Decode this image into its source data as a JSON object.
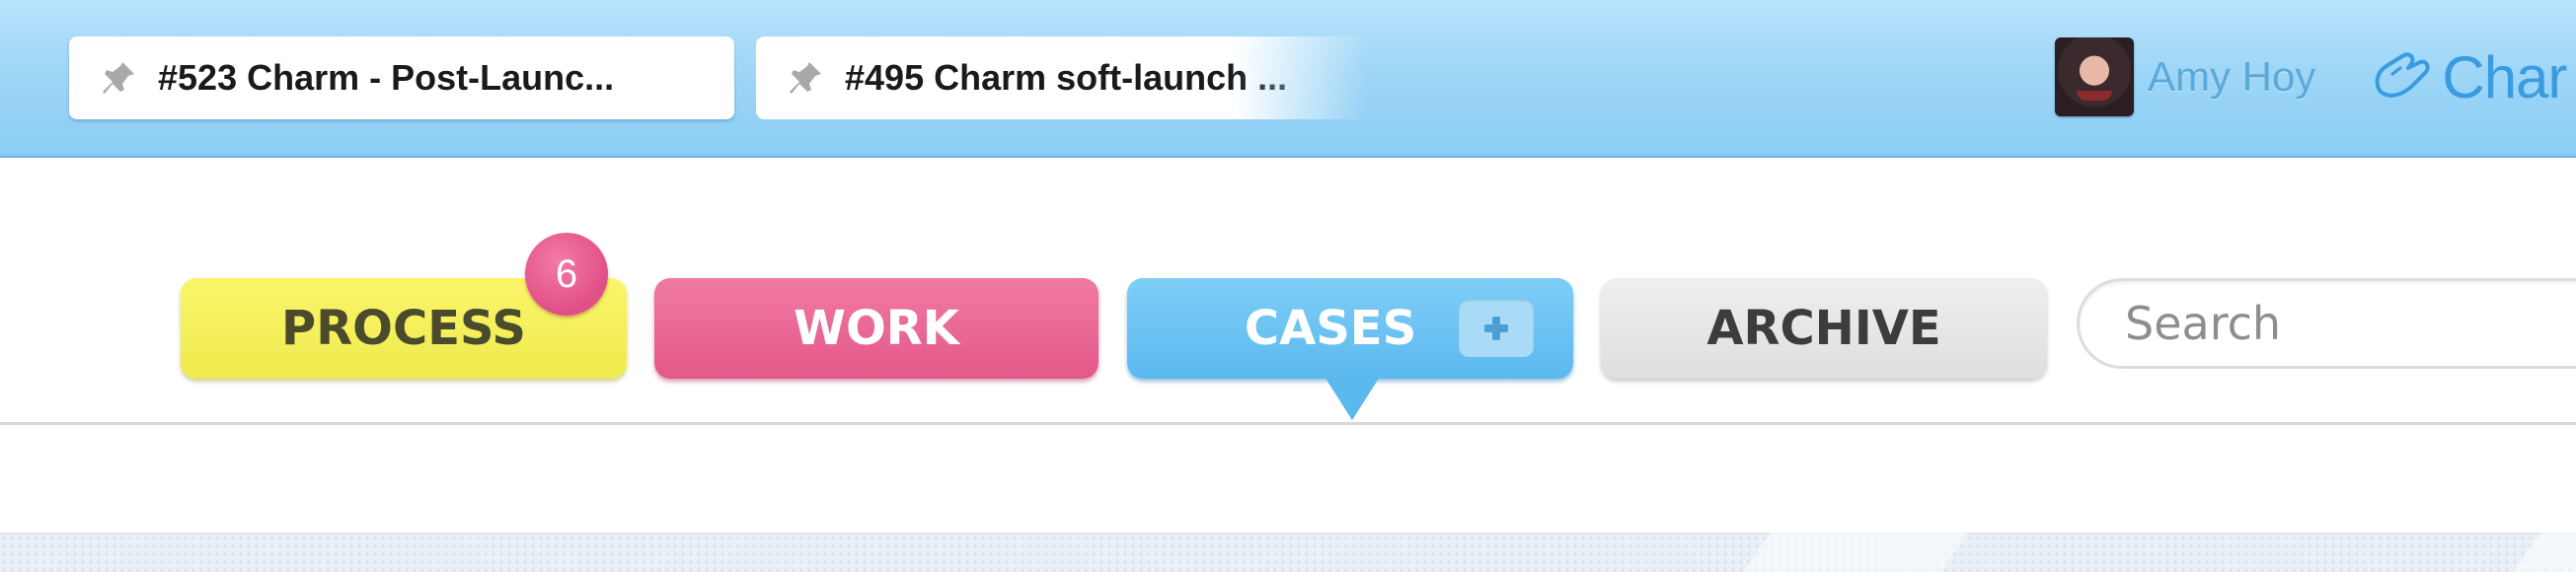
{
  "topbar": {
    "pinned_tabs": [
      {
        "label": "#523 Charm - Post-Launc..."
      },
      {
        "label": "#495 Charm soft-launch ..."
      }
    ],
    "user": {
      "name": "Amy Hoy"
    },
    "brand": {
      "name": "Char"
    }
  },
  "nav": {
    "process": {
      "label": "PROCESS",
      "badge": "6"
    },
    "work": {
      "label": "WORK"
    },
    "cases": {
      "label": "CASES",
      "active": true
    },
    "archive": {
      "label": "ARCHIVE"
    }
  },
  "search": {
    "placeholder": "Search",
    "value": ""
  },
  "colors": {
    "topbar": "#9fd6f7",
    "process": "#f4f05a",
    "work": "#e8648f",
    "cases": "#62bdf0",
    "archive": "#e5e5e5",
    "badge": "#e5538a"
  },
  "icons": {
    "pin": "pin-icon",
    "brand": "charm-logo-icon",
    "add_case": "plus-icon"
  }
}
